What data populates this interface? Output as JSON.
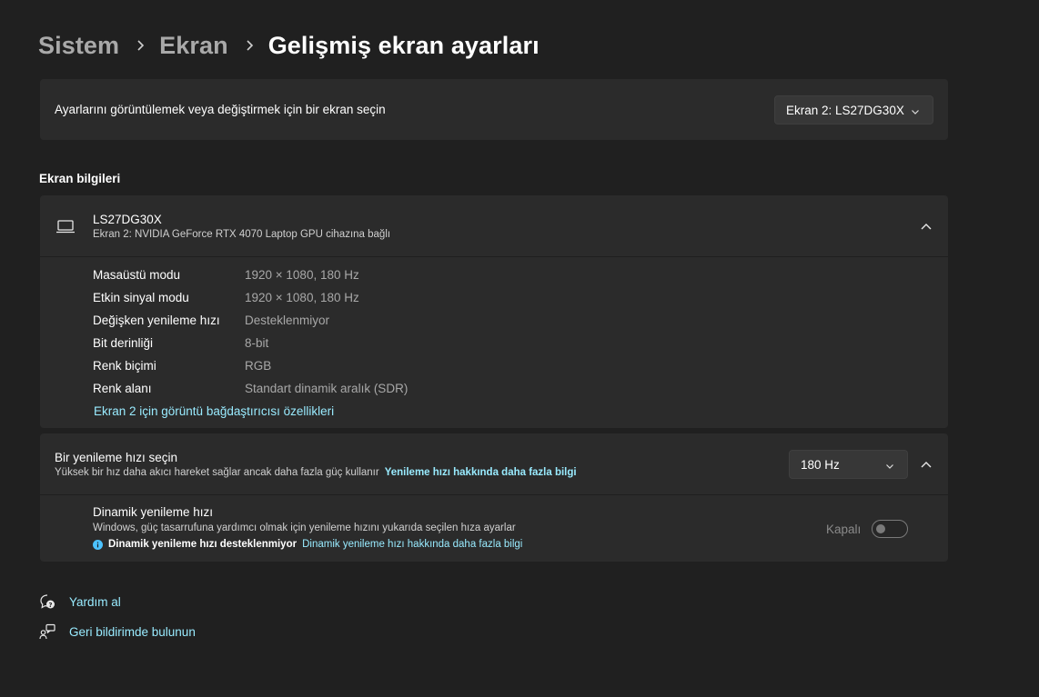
{
  "breadcrumb": {
    "items": [
      "Sistem",
      "Ekran"
    ],
    "current": "Gelişmiş ekran ayarları"
  },
  "display_select": {
    "label": "Ayarlarını görüntülemek veya değiştirmek için bir ekran seçin",
    "value": "Ekran 2: LS27DG30X"
  },
  "display_info": {
    "section_title": "Ekran bilgileri",
    "name": "LS27DG30X",
    "subtitle": "Ekran 2: NVIDIA GeForce RTX 4070 Laptop GPU cihazına bağlı",
    "rows": [
      {
        "label": "Masaüstü modu",
        "value": "1920 × 1080, 180 Hz"
      },
      {
        "label": "Etkin sinyal modu",
        "value": "1920 × 1080, 180 Hz"
      },
      {
        "label": "Değişken yenileme hızı",
        "value": "Desteklenmiyor"
      },
      {
        "label": "Bit derinliği",
        "value": "8-bit"
      },
      {
        "label": "Renk biçimi",
        "value": "RGB"
      },
      {
        "label": "Renk alanı",
        "value": "Standart dinamik aralık (SDR)"
      }
    ],
    "adapter_link": "Ekran 2 için görüntü bağdaştırıcısı özellikleri"
  },
  "refresh": {
    "title": "Bir yenileme hızı seçin",
    "description": "Yüksek bir hız daha akıcı hareket sağlar ancak daha fazla güç kullanır",
    "learn_more": "Yenileme hızı hakkında daha fazla bilgi",
    "value": "180 Hz"
  },
  "dynamic_refresh": {
    "title": "Dinamik yenileme hızı",
    "description": "Windows, güç tasarrufuna yardımcı olmak için yenileme hızını yukarıda seçilen hıza ayarlar",
    "warning": "Dinamik yenileme hızı desteklenmiyor",
    "learn_more": "Dinamik yenileme hızı hakkında daha fazla bilgi",
    "toggle_state": "Kapalı"
  },
  "footer": {
    "help": "Yardım al",
    "feedback": "Geri bildirimde bulunun"
  },
  "colors": {
    "background": "#202020",
    "card": "#2b2b2b",
    "link": "#99ebff",
    "info": "#4cc2ff"
  },
  "icons": {
    "chevron_right": "chevron-right-icon",
    "chevron_down": "chevron-down-icon",
    "chevron_up": "chevron-up-icon",
    "laptop": "laptop-icon",
    "info": "info-icon",
    "help": "help-icon",
    "feedback": "feedback-icon"
  }
}
